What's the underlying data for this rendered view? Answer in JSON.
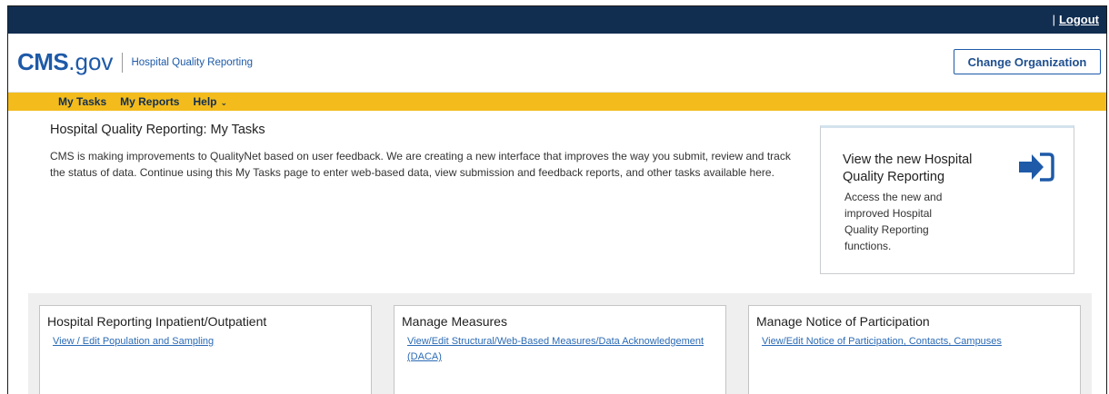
{
  "topbar": {
    "separator": "|",
    "logout": "Logout"
  },
  "header": {
    "logo_cms": "CMS",
    "logo_gov": ".gov",
    "app_name": "Hospital Quality Reporting",
    "change_org": "Change Organization"
  },
  "nav": {
    "items": [
      "My Tasks",
      "My Reports",
      "Help"
    ],
    "help_chevron": "⌄"
  },
  "intro": {
    "title": "Hospital Quality Reporting: My Tasks",
    "body": "CMS is making improvements to QualityNet based on user feedback. We are creating a new interface that improves the way you submit, review and track the status of data. Continue using this My Tasks page to enter web-based data, view submission and feedback reports, and other tasks available here."
  },
  "promo": {
    "title": "View the new Hospital Quality Reporting",
    "desc": "Access the new and improved Hospital Quality Reporting functions.",
    "icon": "sign-in-arrow-icon",
    "icon_color": "#1e5aa8"
  },
  "cards": [
    {
      "title": "Hospital Reporting Inpatient/Outpatient",
      "link": "View / Edit Population and Sampling"
    },
    {
      "title": "Manage Measures",
      "link": "View/Edit Structural/Web-Based Measures/Data Acknowledgement (DACA)"
    },
    {
      "title": "Manage Notice of Participation",
      "link": "View/Edit Notice of Participation, Contacts, Campuses"
    }
  ],
  "colors": {
    "topbar": "#112e51",
    "nav": "#f3bc1c",
    "brand": "#1e5aa8",
    "panel": "#efefef"
  }
}
